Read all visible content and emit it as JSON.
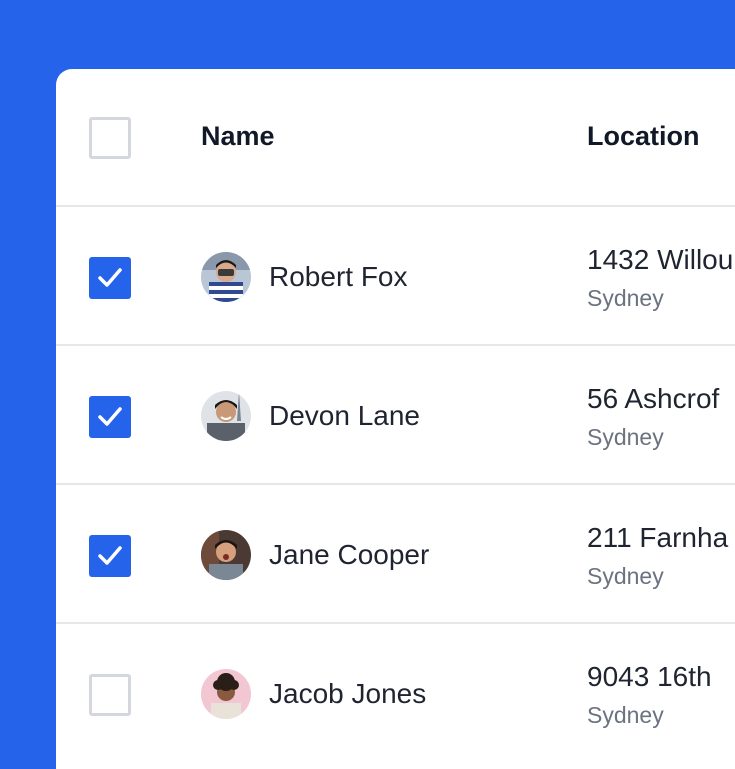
{
  "colors": {
    "accent": "#2563eb",
    "divider": "#e5e7eb",
    "muted": "#6b7280",
    "text": "#1f2430"
  },
  "table": {
    "headers": {
      "name": "Name",
      "location": "Location"
    },
    "rows": [
      {
        "name": "Robert Fox",
        "address": "1432 Willou",
        "city": "Sydney",
        "checked": true,
        "avatar": "avatar-photo"
      },
      {
        "name": "Devon Lane",
        "address": "56 Ashcrof",
        "city": "Sydney",
        "checked": true,
        "avatar": "avatar-photo"
      },
      {
        "name": "Jane Cooper",
        "address": "211 Farnha",
        "city": "Sydney",
        "checked": true,
        "avatar": "avatar-photo"
      },
      {
        "name": "Jacob Jones",
        "address": "9043 16th",
        "city": "Sydney",
        "checked": false,
        "avatar": "avatar-photo"
      }
    ]
  }
}
